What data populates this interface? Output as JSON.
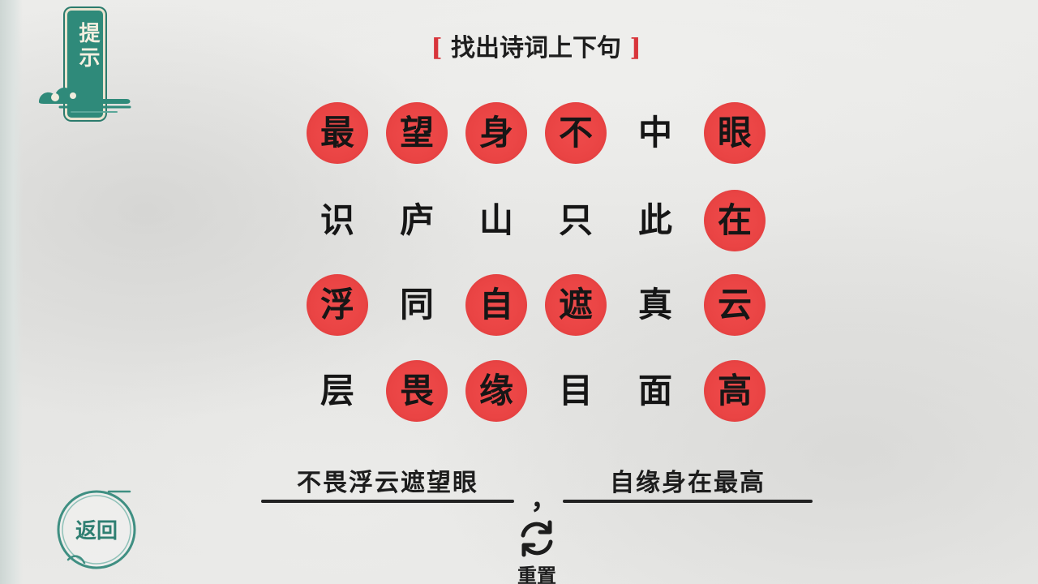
{
  "hint": {
    "label": "提示"
  },
  "instruction": {
    "title": "找出诗词上下句"
  },
  "grid": {
    "rows": [
      [
        {
          "char": "最",
          "highlighted": true
        },
        {
          "char": "望",
          "highlighted": true
        },
        {
          "char": "身",
          "highlighted": true
        },
        {
          "char": "不",
          "highlighted": true
        },
        {
          "char": "中",
          "highlighted": false
        },
        {
          "char": "眼",
          "highlighted": true
        }
      ],
      [
        {
          "char": "识",
          "highlighted": false
        },
        {
          "char": "庐",
          "highlighted": false
        },
        {
          "char": "山",
          "highlighted": false
        },
        {
          "char": "只",
          "highlighted": false
        },
        {
          "char": "此",
          "highlighted": false
        },
        {
          "char": "在",
          "highlighted": true
        }
      ],
      [
        {
          "char": "浮",
          "highlighted": true
        },
        {
          "char": "同",
          "highlighted": false
        },
        {
          "char": "自",
          "highlighted": true
        },
        {
          "char": "遮",
          "highlighted": true
        },
        {
          "char": "真",
          "highlighted": false
        },
        {
          "char": "云",
          "highlighted": true
        }
      ],
      [
        {
          "char": "层",
          "highlighted": false
        },
        {
          "char": "畏",
          "highlighted": true
        },
        {
          "char": "缘",
          "highlighted": true
        },
        {
          "char": "目",
          "highlighted": false
        },
        {
          "char": "面",
          "highlighted": false
        },
        {
          "char": "高",
          "highlighted": true
        }
      ]
    ]
  },
  "answers": {
    "first_line": "不畏浮云遮望眼",
    "separator": "，",
    "second_line": "自缘身在最高"
  },
  "reset": {
    "label": "重置"
  },
  "back": {
    "label": "返回"
  },
  "colors": {
    "highlight": "#ea4444",
    "accent": "#2f8a7a",
    "bracket": "#d8343a",
    "text": "#161616"
  },
  "icons": {
    "reset": "refresh-icon",
    "hint_decoration": "cloud-icon",
    "back_decoration": "circle-ring-icon"
  }
}
